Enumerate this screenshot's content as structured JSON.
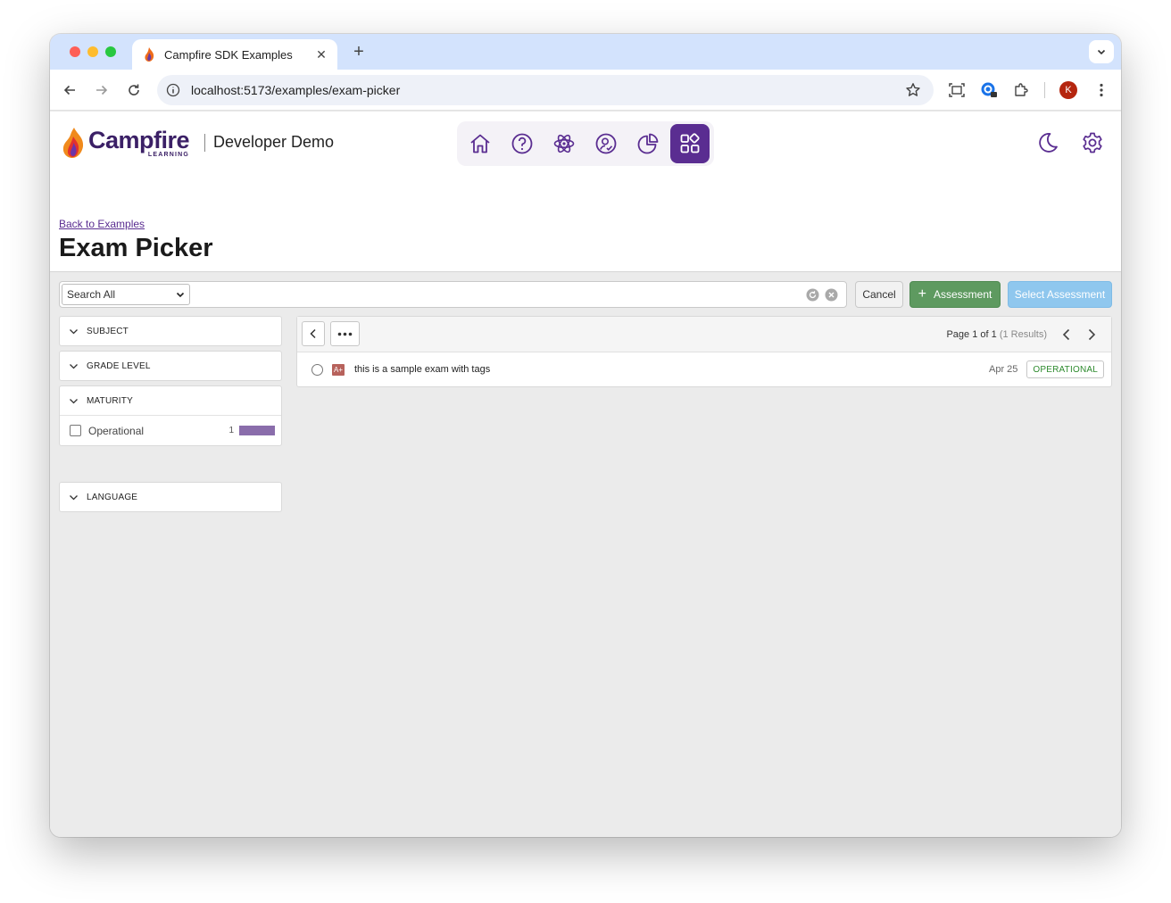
{
  "browser": {
    "tab_title": "Campfire SDK Examples",
    "url": "localhost:5173/examples/exam-picker",
    "profile_initial": "K"
  },
  "header": {
    "logo_word": "Campfire",
    "logo_sub": "LEARNING",
    "subtitle": "Developer Demo",
    "nav_icons": [
      "home-icon",
      "help-icon",
      "atom-icon",
      "badge-check-icon",
      "pie-chart-icon",
      "apps-icon"
    ],
    "active_nav": "apps-icon",
    "accent": "#5a2d91"
  },
  "page": {
    "back_link": "Back to Examples",
    "title": "Exam Picker"
  },
  "search": {
    "scope_selected": "Search All",
    "query": "",
    "cancel_label": "Cancel",
    "add_label": "Assessment",
    "select_label": "Select Assessment"
  },
  "facets": {
    "subject": "SUBJECT",
    "grade_level": "GRADE LEVEL",
    "maturity": "MATURITY",
    "maturity_option": {
      "label": "Operational",
      "count": "1"
    },
    "language": "LANGUAGE"
  },
  "results": {
    "paging_main": "Page 1 of 1",
    "paging_count": "(1 Results)",
    "items": [
      {
        "title": "this is a sample exam with tags",
        "date": "Apr 25",
        "status": "OPERATIONAL",
        "type_glyph": "A+"
      }
    ]
  }
}
